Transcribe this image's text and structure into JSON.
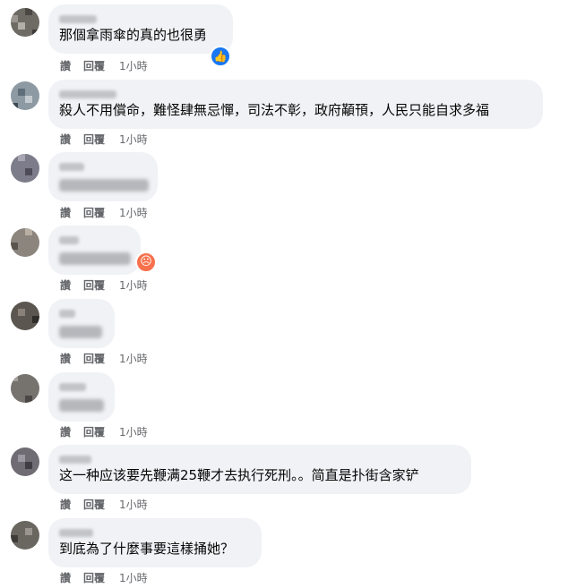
{
  "comments": [
    {
      "text": "那個拿雨傘的真的也很勇",
      "reaction": "like-icon"
    },
    {
      "text": "殺人不用償命，難怪肆無忌憚，司法不彰，政府顢頇，人民只能自求多福"
    },
    {
      "text": ""
    },
    {
      "text": "",
      "reaction": "angry-icon"
    },
    {
      "text": ""
    },
    {
      "text": ""
    },
    {
      "text": "这一种应该要先鞭满25鞭才去执行死刑。。简直是扑街含家铲"
    },
    {
      "text": "到底為了什麼事要這樣捅她？"
    }
  ],
  "actions": {
    "like": "讚",
    "reply": "回覆",
    "time": "1小時"
  },
  "colors": {
    "bubble": "#f0f2f5",
    "meta": "#65676b",
    "like": "#1877f2",
    "angry": "#f7714c"
  }
}
